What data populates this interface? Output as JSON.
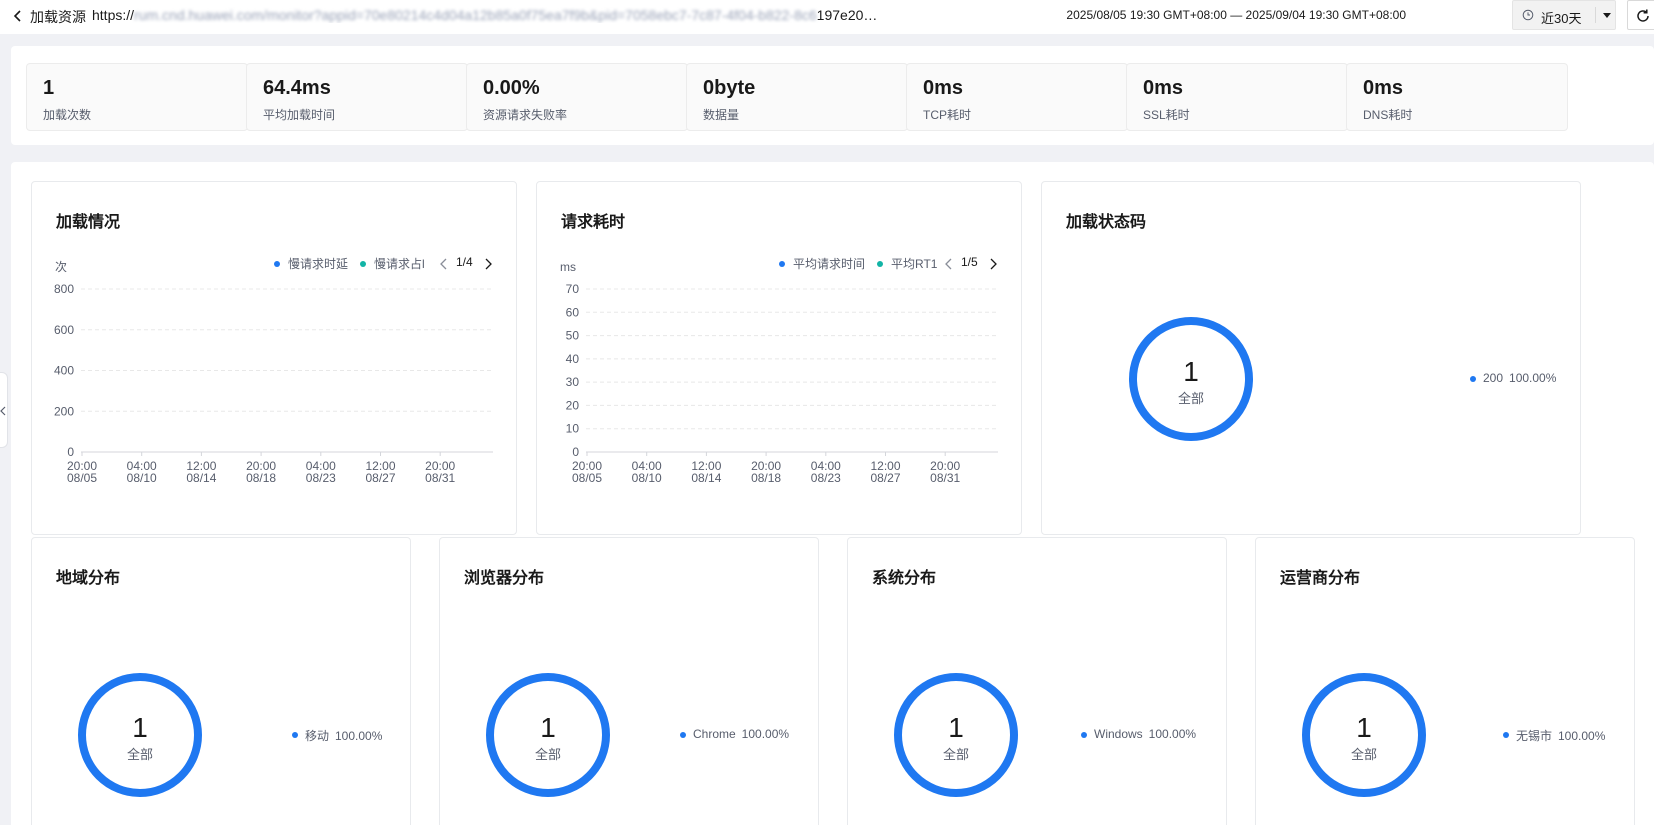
{
  "header": {
    "title": "加载资源",
    "url_visible": "https://",
    "url_blurred": "rum.cnd.huawei.com/monitor?appid=70e80214c4d04a12b85a0f75ea7f9b&pid=7058ebc7-7c87-4f04-b822-8c6",
    "url_tail": "197e20…",
    "date_range": "2025/08/05 19:30 GMT+08:00 — 2025/09/04 19:30 GMT+08:00",
    "time_select": "近30天"
  },
  "stats": [
    {
      "value": "1",
      "label": "加载次数"
    },
    {
      "value": "64.4ms",
      "label": "平均加载时间"
    },
    {
      "value": "0.00%",
      "label": "资源请求失败率"
    },
    {
      "value": "0byte",
      "label": "数据量"
    },
    {
      "value": "0ms",
      "label": "TCP耗时"
    },
    {
      "value": "0ms",
      "label": "SSL耗时"
    },
    {
      "value": "0ms",
      "label": "DNS耗时"
    }
  ],
  "colors": {
    "accent": "#1f78f1",
    "teal": "#12b4a6",
    "grid": "#e8e8e8",
    "axis_text": "#575d6c"
  },
  "chart_data": [
    {
      "type": "line",
      "title": "加载情况",
      "ylabel": "次",
      "xlabel": "",
      "ylim": [
        0,
        800
      ],
      "yticks": [
        "0",
        "200",
        "400",
        "600",
        "800"
      ],
      "x": [
        "20:00\n08/05",
        "04:00\n08/10",
        "12:00\n08/14",
        "20:00\n08/18",
        "04:00\n08/23",
        "12:00\n08/27",
        "20:00\n08/31"
      ],
      "legend": {
        "items": [
          {
            "name": "慢请求时延",
            "color": "#1f78f1"
          },
          {
            "name": "慢请求占比",
            "display": "慢请求占l",
            "color": "#12b4a6"
          }
        ],
        "page": "1/4",
        "placement": "top-right"
      },
      "series": [],
      "grid": true
    },
    {
      "type": "line",
      "title": "请求耗时",
      "ylabel": "ms",
      "xlabel": "",
      "ylim": [
        0,
        70
      ],
      "yticks": [
        "0",
        "10",
        "20",
        "30",
        "40",
        "50",
        "60",
        "70"
      ],
      "x": [
        "20:00\n08/05",
        "04:00\n08/10",
        "12:00\n08/14",
        "20:00\n08/18",
        "04:00\n08/23",
        "12:00\n08/27",
        "20:00\n08/31"
      ],
      "legend": {
        "items": [
          {
            "name": "平均请求时间",
            "color": "#1f78f1"
          },
          {
            "name": "平均RTT",
            "display": "平均RT1",
            "color": "#12b4a6"
          }
        ],
        "page": "1/5",
        "placement": "top-right"
      },
      "series": [],
      "grid": true
    },
    {
      "type": "pie",
      "title": "加载状态码",
      "center_value": "1",
      "center_label": "全部",
      "slices": [
        {
          "name": "200",
          "value": 1,
          "percent": "100.00%",
          "color": "#1f78f1"
        }
      ]
    },
    {
      "type": "pie",
      "title": "地域分布",
      "center_value": "1",
      "center_label": "全部",
      "slices": [
        {
          "name": "移动",
          "value": 1,
          "percent": "100.00%",
          "color": "#1f78f1"
        }
      ]
    },
    {
      "type": "pie",
      "title": "浏览器分布",
      "center_value": "1",
      "center_label": "全部",
      "slices": [
        {
          "name": "Chrome",
          "value": 1,
          "percent": "100.00%",
          "color": "#1f78f1"
        }
      ]
    },
    {
      "type": "pie",
      "title": "系统分布",
      "center_value": "1",
      "center_label": "全部",
      "slices": [
        {
          "name": "Windows",
          "value": 1,
          "percent": "100.00%",
          "color": "#1f78f1"
        }
      ]
    },
    {
      "type": "pie",
      "title": "运营商分布",
      "center_value": "1",
      "center_label": "全部",
      "slices": [
        {
          "name": "无锡市",
          "value": 1,
          "percent": "100.00%",
          "color": "#1f78f1"
        }
      ]
    }
  ]
}
